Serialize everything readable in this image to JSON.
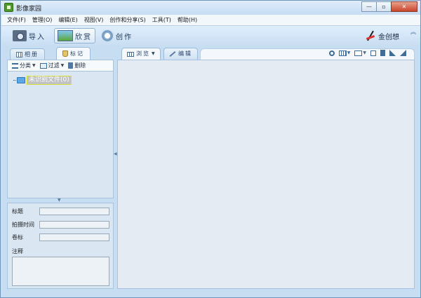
{
  "window": {
    "title": "影像家园",
    "buttons": {
      "minimize": "—",
      "maximize": "▫",
      "close": "✕"
    }
  },
  "menu": [
    "文件(F)",
    "管理(O)",
    "编辑(E)",
    "视图(V)",
    "创作和分享(S)",
    "工具(T)",
    "帮助(H)"
  ],
  "toolbar": {
    "import": "导入",
    "appreciate": "欣赏",
    "create": "创作",
    "brand": "金创想"
  },
  "left_panel": {
    "tabs": [
      "相册",
      "标记"
    ],
    "active_tab": "标记",
    "tools": {
      "sort": "分类",
      "filter": "过滤",
      "delete": "删除"
    },
    "tree": {
      "label": "未识别文件(0)"
    },
    "properties": {
      "title_label": "标题",
      "time_label": "拍摄时间",
      "volume_label": "卷标",
      "note_label": "注释"
    }
  },
  "main_panel": {
    "tabs": [
      "浏览",
      "编辑"
    ],
    "active_tab": "浏览",
    "icons": [
      "zoom-icon",
      "thumbnail-view-icon",
      "panel-view-icon",
      "select-icon",
      "trash-icon",
      "rotate-left-icon",
      "rotate-right-icon"
    ]
  }
}
